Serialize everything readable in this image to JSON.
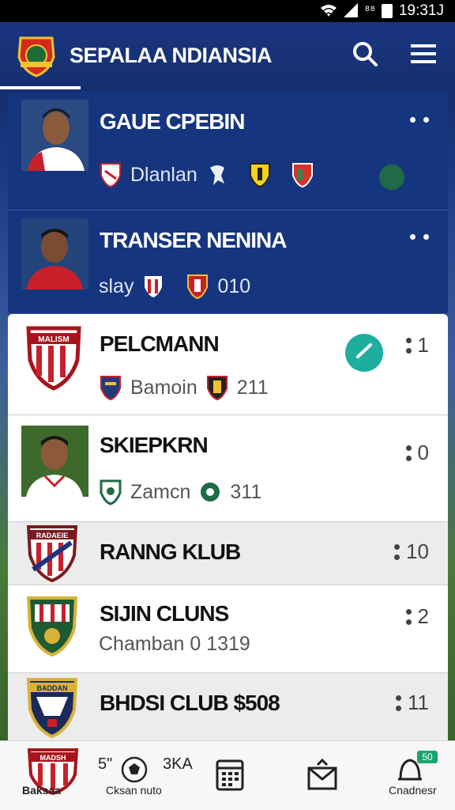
{
  "status_bar": {
    "signal_text": "⁸⁸",
    "time": "19:31J",
    "icons": [
      "wifi-icon",
      "signal-icon",
      "battery-icon"
    ]
  },
  "header": {
    "title": "SEPALAA NDIANSIA",
    "icons": [
      "club-logo-icon",
      "search-icon",
      "menu-icon"
    ]
  },
  "cards": [
    {
      "title": "GAUE CPEBIN",
      "meta_text": "Dlanlan",
      "style": "dark"
    },
    {
      "title": "TRANSER NENINA",
      "meta_prefix": "slay",
      "meta_suffix": "010",
      "style": "dark"
    },
    {
      "title": "PELCMANN",
      "crest_text": "MALISM",
      "meta_text": "Bamoin",
      "meta_num": "211",
      "count": "1",
      "style": "light"
    },
    {
      "title": "SKIEPKRN",
      "meta_text": "Zamcn",
      "meta_num": "311",
      "count": "0",
      "style": "light"
    },
    {
      "title": "RANNG KLUB",
      "crest_text": "RADAEIE",
      "count": "10",
      "style": "grey"
    },
    {
      "title": "SIJIN CLUNS",
      "subtitle": "Chamban 0 1319",
      "count": "2",
      "style": "light"
    },
    {
      "title": "BHDSI CLUB  $508",
      "crest_text": "BADDAN",
      "count": "11",
      "style": "grey"
    }
  ],
  "bottom_nav": {
    "item1_label": "Baksaa",
    "item1_crest_text": "MADSH",
    "item2_num": "5\"",
    "item2_label": "Cksan nuto",
    "item2_extra": "3KA",
    "item5_label": "Cnadnesr",
    "item5_badge": "50"
  },
  "colors": {
    "header_blue": "#16357f",
    "accent_teal": "#1fae9e",
    "crest_red": "#c8202a"
  }
}
